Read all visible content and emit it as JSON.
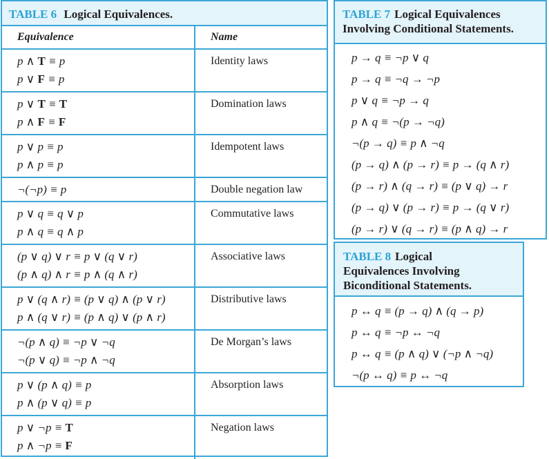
{
  "table6": {
    "number": "TABLE 6",
    "title": "Logical Equivalences.",
    "headers": {
      "equivalence": "Equivalence",
      "name": "Name"
    },
    "rows": [
      {
        "equivalences": [
          "p ∧ T ≡ p",
          "p ∨ F ≡ p"
        ],
        "name": "Identity laws"
      },
      {
        "equivalences": [
          "p ∨ T ≡ T",
          "p ∧ F ≡ F"
        ],
        "name": "Domination laws"
      },
      {
        "equivalences": [
          "p ∨ p ≡ p",
          "p ∧ p ≡ p"
        ],
        "name": "Idempotent laws"
      },
      {
        "equivalences": [
          "¬(¬p) ≡ p"
        ],
        "name": "Double negation law"
      },
      {
        "equivalences": [
          "p ∨ q ≡ q ∨ p",
          "p ∧ q ≡ q ∧ p"
        ],
        "name": "Commutative laws"
      },
      {
        "equivalences": [
          "(p ∨ q) ∨ r ≡ p ∨ (q ∨ r)",
          "(p ∧ q) ∧ r ≡ p ∧ (q ∧ r)"
        ],
        "name": "Associative laws"
      },
      {
        "equivalences": [
          "p ∨ (q ∧ r) ≡ (p ∨ q) ∧ (p ∨ r)",
          "p ∧ (q ∨ r) ≡ (p ∧ q) ∨ (p ∧ r)"
        ],
        "name": "Distributive laws"
      },
      {
        "equivalences": [
          "¬(p ∧ q) ≡ ¬p ∨ ¬q",
          "¬(p ∨ q) ≡ ¬p ∧ ¬q"
        ],
        "name": "De Morgan’s laws"
      },
      {
        "equivalences": [
          "p ∨ (p ∧ q) ≡ p",
          "p ∧ (p ∨ q) ≡ p"
        ],
        "name": "Absorption laws"
      },
      {
        "equivalences": [
          "p ∨ ¬p ≡ T",
          "p ∧ ¬p ≡ F"
        ],
        "name": "Negation laws"
      }
    ]
  },
  "table7": {
    "number": "TABLE 7",
    "title_line1": "Logical Equivalences",
    "title_line2": "Involving Conditional Statements.",
    "equivalences": [
      "p → q ≡ ¬p ∨ q",
      "p → q ≡ ¬q → ¬p",
      "p ∨ q ≡ ¬p → q",
      "p ∧ q ≡ ¬(p → ¬q)",
      "¬(p → q) ≡ p ∧ ¬q",
      "(p → q) ∧ (p → r) ≡ p → (q ∧ r)",
      "(p → r) ∧ (q → r) ≡ (p ∨ q) → r",
      "(p → q) ∨ (p → r) ≡ p → (q ∨ r)",
      "(p → r) ∨ (q → r) ≡ (p ∧ q) → r"
    ]
  },
  "table8": {
    "number": "TABLE 8",
    "title_line1": "Logical",
    "title_line2": "Equivalences Involving",
    "title_line3": "Biconditional Statements.",
    "equivalences": [
      "p ↔ q ≡ (p → q) ∧ (q → p)",
      "p ↔ q ≡ ¬p ↔ ¬q",
      "p ↔ q ≡ (p ∧ q) ∨ (¬p ∧ ¬q)",
      "¬(p ↔ q) ≡ p ↔ ¬q"
    ]
  },
  "colors": {
    "accent": "#2aa3d4",
    "border": "#3aa6d6",
    "caption_bg": "#e3f4fb",
    "text": "#231f20"
  }
}
